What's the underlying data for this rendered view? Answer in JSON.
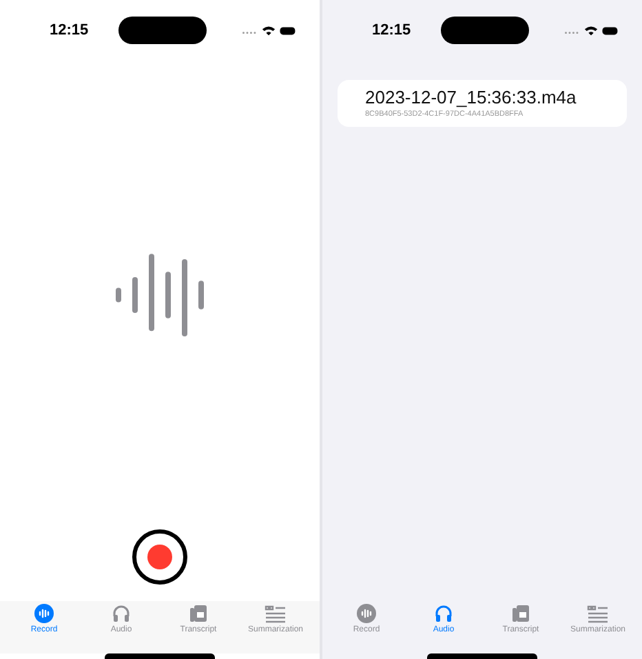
{
  "screens": [
    {
      "kind": "record",
      "status_bar": {
        "time": "12:15"
      },
      "tabs": [
        {
          "label": "Record",
          "selected": true
        },
        {
          "label": "Audio",
          "selected": false
        },
        {
          "label": "Transcript",
          "selected": false
        },
        {
          "label": "Summarization",
          "selected": false
        }
      ]
    },
    {
      "kind": "list",
      "status_bar": {
        "time": "12:15"
      },
      "recordings": [
        {
          "name": "2023-12-07_15:36:33.m4a",
          "id": "8C9B40F5-53D2-4C1F-97DC-4A41A5BD8FFA"
        }
      ],
      "tabs": [
        {
          "label": "Record",
          "selected": false
        },
        {
          "label": "Audio",
          "selected": true
        },
        {
          "label": "Transcript",
          "selected": false
        },
        {
          "label": "Summarization",
          "selected": false
        }
      ]
    }
  ]
}
